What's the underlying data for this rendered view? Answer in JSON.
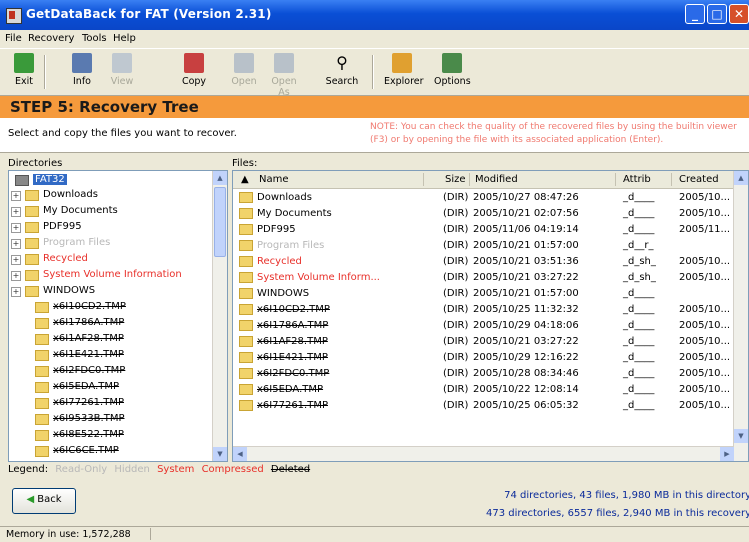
{
  "window": {
    "title": "GetDataBack for FAT (Version 2.31)"
  },
  "menu": [
    "File",
    "Recovery",
    "Tools",
    "Help"
  ],
  "toolbar": [
    {
      "label": "Exit",
      "icon": "exit-icon",
      "enabled": true
    },
    {
      "label": "Info",
      "icon": "info-icon",
      "enabled": true
    },
    {
      "label": "View",
      "icon": "view-icon",
      "enabled": false
    },
    {
      "label": "Copy",
      "icon": "copy-icon",
      "enabled": true
    },
    {
      "label": "Open",
      "icon": "open-icon",
      "enabled": false
    },
    {
      "label": "Open As",
      "icon": "open-as-icon",
      "enabled": false
    },
    {
      "label": "Search",
      "icon": "search-icon",
      "enabled": true
    },
    {
      "label": "Explorer",
      "icon": "explorer-icon",
      "enabled": true
    },
    {
      "label": "Options",
      "icon": "options-icon",
      "enabled": true
    }
  ],
  "step": {
    "title": "STEP 5: Recovery Tree"
  },
  "instructions": {
    "left": "Select and copy the files you want to recover.",
    "note": "NOTE: You can check the quality of the recovered files by using the builtin viewer (F3) or by opening the file with its associated application (Enter)."
  },
  "directories": {
    "header": "Directories",
    "root": "FAT32",
    "items": [
      {
        "name": "Downloads",
        "style": "normal"
      },
      {
        "name": "My Documents",
        "style": "normal"
      },
      {
        "name": "PDF995",
        "style": "normal"
      },
      {
        "name": "Program Files",
        "style": "gray"
      },
      {
        "name": "Recycled",
        "style": "red"
      },
      {
        "name": "System Volume Information",
        "style": "red"
      },
      {
        "name": "WINDOWS",
        "style": "normal"
      },
      {
        "name": "x6I10CD2.TMP",
        "style": "deleted"
      },
      {
        "name": "x6I1786A.TMP",
        "style": "deleted"
      },
      {
        "name": "x6I1AF28.TMP",
        "style": "deleted"
      },
      {
        "name": "x6I1E421.TMP",
        "style": "deleted"
      },
      {
        "name": "x6I2FDC0.TMP",
        "style": "deleted"
      },
      {
        "name": "x6I5EDA.TMP",
        "style": "deleted"
      },
      {
        "name": "x6I77261.TMP",
        "style": "deleted"
      },
      {
        "name": "x6I9533B.TMP",
        "style": "deleted"
      },
      {
        "name": "x6I8E522.TMP",
        "style": "deleted"
      },
      {
        "name": "x6IC6CE.TMP",
        "style": "deleted"
      }
    ]
  },
  "files": {
    "header": "Files:",
    "columns": [
      "Name",
      "Size",
      "Modified",
      "Attrib",
      "Created"
    ],
    "rows": [
      {
        "name": "Downloads",
        "size": "(DIR)",
        "modified": "2005/10/27 08:47:26",
        "attrib": "_d____",
        "created": "2005/10...",
        "style": "normal"
      },
      {
        "name": "My Documents",
        "size": "(DIR)",
        "modified": "2005/10/21 02:07:56",
        "attrib": "_d____",
        "created": "2005/10...",
        "style": "normal"
      },
      {
        "name": "PDF995",
        "size": "(DIR)",
        "modified": "2005/11/06 04:19:14",
        "attrib": "_d____",
        "created": "2005/11...",
        "style": "normal"
      },
      {
        "name": "Program Files",
        "size": "(DIR)",
        "modified": "2005/10/21 01:57:00",
        "attrib": "_d__r_",
        "created": "",
        "style": "gray"
      },
      {
        "name": "Recycled",
        "size": "(DIR)",
        "modified": "2005/10/21 03:51:36",
        "attrib": "_d_sh_",
        "created": "2005/10...",
        "style": "red"
      },
      {
        "name": "System Volume Inform...",
        "size": "(DIR)",
        "modified": "2005/10/21 03:27:22",
        "attrib": "_d_sh_",
        "created": "2005/10...",
        "style": "red"
      },
      {
        "name": "WINDOWS",
        "size": "(DIR)",
        "modified": "2005/10/21 01:57:00",
        "attrib": "_d____",
        "created": "",
        "style": "normal"
      },
      {
        "name": "x6I10CD2.TMP",
        "size": "(DIR)",
        "modified": "2005/10/25 11:32:32",
        "attrib": "_d____",
        "created": "2005/10...",
        "style": "deleted"
      },
      {
        "name": "x6I1786A.TMP",
        "size": "(DIR)",
        "modified": "2005/10/29 04:18:06",
        "attrib": "_d____",
        "created": "2005/10...",
        "style": "deleted"
      },
      {
        "name": "x6I1AF28.TMP",
        "size": "(DIR)",
        "modified": "2005/10/21 03:27:22",
        "attrib": "_d____",
        "created": "2005/10...",
        "style": "deleted"
      },
      {
        "name": "x6I1E421.TMP",
        "size": "(DIR)",
        "modified": "2005/10/29 12:16:22",
        "attrib": "_d____",
        "created": "2005/10...",
        "style": "deleted"
      },
      {
        "name": "x6I2FDC0.TMP",
        "size": "(DIR)",
        "modified": "2005/10/28 08:34:46",
        "attrib": "_d____",
        "created": "2005/10...",
        "style": "deleted"
      },
      {
        "name": "x6I5EDA.TMP",
        "size": "(DIR)",
        "modified": "2005/10/22 12:08:14",
        "attrib": "_d____",
        "created": "2005/10...",
        "style": "deleted"
      },
      {
        "name": "x6I77261.TMP",
        "size": "(DIR)",
        "modified": "2005/10/25 06:05:32",
        "attrib": "_d____",
        "created": "2005/10...",
        "style": "deleted"
      }
    ]
  },
  "legend": {
    "label": "Legend:",
    "items": [
      {
        "text": "Read-Only",
        "style": "gray"
      },
      {
        "text": "Hidden",
        "style": "gray"
      },
      {
        "text": "System",
        "style": "red"
      },
      {
        "text": "Compressed",
        "style": "red"
      },
      {
        "text": "Deleted",
        "style": "deleted"
      }
    ]
  },
  "back_button": "Back",
  "stats": {
    "current": "74 directories, 43 files, 1,980 MB in this directory",
    "total": "473 directories, 6557 files, 2,940 MB in this recovery"
  },
  "status": {
    "memory": "Memory in use: 1,572,288"
  }
}
